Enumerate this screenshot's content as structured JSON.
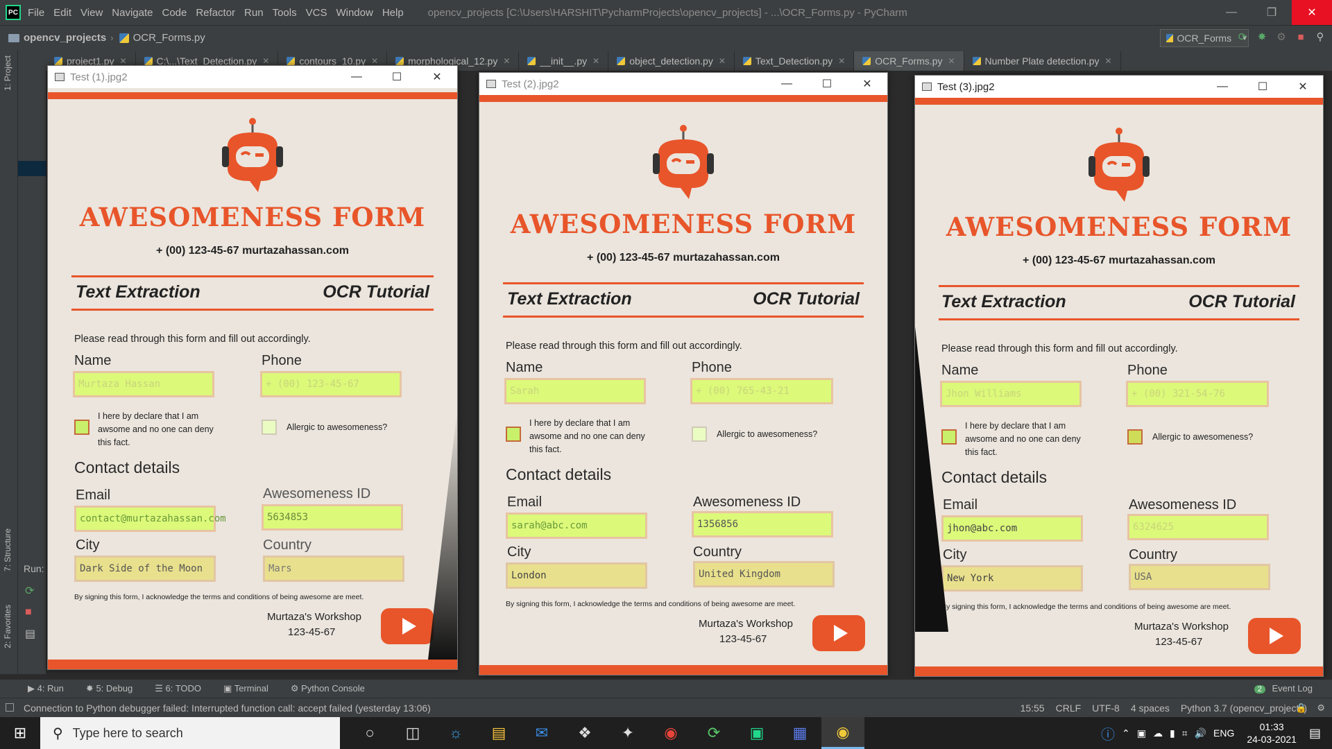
{
  "ide": {
    "logo_text": "PC",
    "menu": [
      "File",
      "Edit",
      "View",
      "Navigate",
      "Code",
      "Refactor",
      "Run",
      "Tools",
      "VCS",
      "Window",
      "Help"
    ],
    "window_title": "opencv_projects [C:\\Users\\HARSHIT\\PycharmProjects\\opencv_projects] - ...\\OCR_Forms.py - PyCharm",
    "breadcrumb_project": "opencv_projects",
    "breadcrumb_file": "OCR_Forms.py",
    "run_config": "OCR_Forms",
    "tabs": [
      {
        "label": "project1.py"
      },
      {
        "label": "C:\\...\\Text_Detection.py"
      },
      {
        "label": "contours_10.py"
      },
      {
        "label": "morphological_12.py"
      },
      {
        "label": "__init__.py"
      },
      {
        "label": "object_detection.py"
      },
      {
        "label": "Text_Detection.py"
      },
      {
        "label": "OCR_Forms.py"
      },
      {
        "label": "Number Plate detection.py"
      }
    ],
    "left_labels": {
      "project": "1: Project",
      "structure": "7: Structure",
      "favorites": "2: Favorites"
    },
    "run_label": "Run:",
    "bottom_tools": [
      "4: Run",
      "5: Debug",
      "6: TODO",
      "Terminal",
      "Python Console"
    ],
    "event_log": "Event Log",
    "event_count": "2",
    "status_message": "Connection to Python debugger failed: Interrupted function call: accept failed (yesterday 13:06)",
    "status_right": [
      "15:55",
      "CRLF",
      "UTF-8",
      "4 spaces",
      "Python 3.7 (opencv_projects)"
    ]
  },
  "taskbar": {
    "search_placeholder": "Type here to search",
    "language": "ENG",
    "time": "01:33",
    "date": "24-03-2021"
  },
  "form_common": {
    "title": "AWESOMENESS FORM",
    "contact": "+ (00) 123-45-67 murtazahassan.com",
    "section_left": "Text Extraction",
    "section_right": "OCR Tutorial",
    "instructions": "Please read through this form and fill out accordingly.",
    "label_name": "Name",
    "label_phone": "Phone",
    "declaration": "I here by declare that I am awsome and no one can deny this fact.",
    "allergic": "Allergic to awesomeness?",
    "contact_details": "Contact details",
    "label_email": "Email",
    "label_id": "Awesomeness ID",
    "label_city": "City",
    "label_country": "Country",
    "footer": "By signing this form, I acknowledge the terms and conditions of being awesome are meet.",
    "sig_name": "Murtaza's Workshop",
    "sig_phone": "123-45-67"
  },
  "windows": [
    {
      "title": "Test (1).jpg2",
      "name": "Murtaza Hassan",
      "phone": "+ (00) 123-45-67",
      "email": "contact@murtazahassan.com",
      "id": "5634853",
      "city": "Dark Side of the Moon",
      "country": "Mars",
      "declare_checked": true,
      "allergic_checked": false
    },
    {
      "title": "Test (2).jpg2",
      "name": "Sarah",
      "phone": "+ (00) 765-43-21",
      "email": "sarah@abc.com",
      "id": "1356856",
      "city": "London",
      "country": "United Kingdom",
      "declare_checked": true,
      "allergic_checked": false
    },
    {
      "title": "Test (3).jpg2",
      "name": "Jhon Williams",
      "phone": "+ (00) 321-54-76",
      "email": "jhon@abc.com",
      "id": "6324625",
      "city": "New York",
      "country": "USA",
      "declare_checked": true,
      "allergic_checked": true
    }
  ]
}
